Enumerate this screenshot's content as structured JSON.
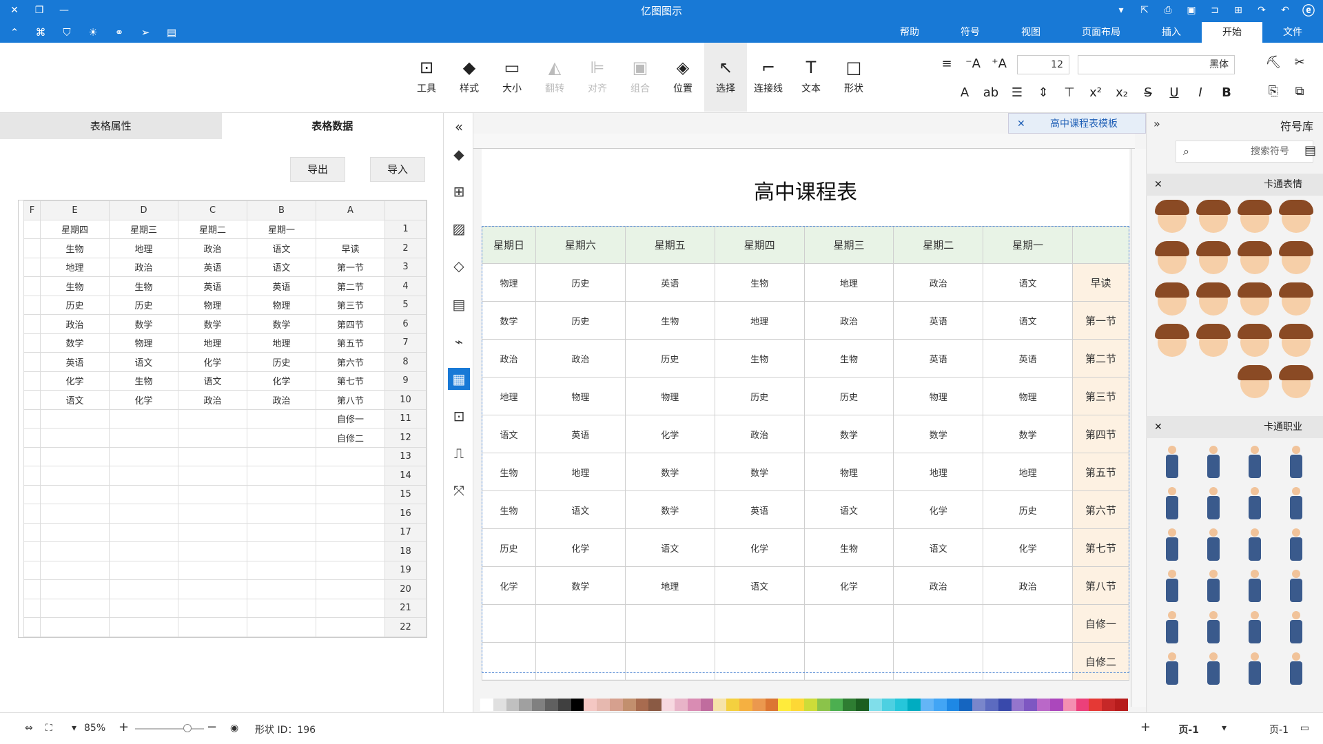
{
  "titlebar": {
    "title": "亿图图示"
  },
  "tabs": [
    "开始",
    "插入",
    "页面布局",
    "视图",
    "符号",
    "帮助"
  ],
  "active_tab": "开始",
  "toolbar": {
    "font_name": "黑体",
    "font_size": "12",
    "tools": [
      {
        "name": "shape",
        "label": "形状",
        "icon": "□"
      },
      {
        "name": "text",
        "label": "文本",
        "icon": "T"
      },
      {
        "name": "connector",
        "label": "连接线",
        "icon": "⌐"
      },
      {
        "name": "select",
        "label": "选择",
        "icon": "↖"
      },
      {
        "name": "position",
        "label": "位置",
        "icon": "◈"
      },
      {
        "name": "group",
        "label": "组合",
        "icon": "▣"
      },
      {
        "name": "align",
        "label": "对齐",
        "icon": "⊫"
      },
      {
        "name": "flip",
        "label": "翻转",
        "icon": "◭"
      },
      {
        "name": "size",
        "label": "大小",
        "icon": "▭"
      },
      {
        "name": "style",
        "label": "样式",
        "icon": "◆"
      },
      {
        "name": "tools",
        "label": "工具",
        "icon": "⊡"
      }
    ]
  },
  "symbols": {
    "title": "符号库",
    "search_placeholder": "搜索符号",
    "lib1": "卡通表情",
    "lib2": "卡通职业"
  },
  "document": {
    "tab_label": "高中课程表模板",
    "title": "高中课程表",
    "days": [
      "星期一",
      "星期二",
      "星期三",
      "星期四",
      "星期五",
      "星期六",
      "星期日"
    ],
    "periods": [
      "早读",
      "第一节",
      "第二节",
      "第三节",
      "第四节",
      "第五节",
      "第六节",
      "第七节",
      "第八节",
      "自修一",
      "自修二"
    ],
    "rows": [
      [
        "语文",
        "政治",
        "地理",
        "生物",
        "英语",
        "历史",
        "物理"
      ],
      [
        "语文",
        "英语",
        "政治",
        "地理",
        "生物",
        "历史",
        "数学"
      ],
      [
        "英语",
        "英语",
        "生物",
        "生物",
        "历史",
        "政治",
        "政治"
      ],
      [
        "物理",
        "物理",
        "历史",
        "历史",
        "物理",
        "物理",
        "地理"
      ],
      [
        "数学",
        "数学",
        "数学",
        "政治",
        "化学",
        "英语",
        "语文"
      ],
      [
        "地理",
        "地理",
        "物理",
        "数学",
        "数学",
        "地理",
        "生物"
      ],
      [
        "历史",
        "化学",
        "语文",
        "英语",
        "数学",
        "语文",
        "生物"
      ],
      [
        "化学",
        "语文",
        "生物",
        "化学",
        "语文",
        "化学",
        "历史"
      ],
      [
        "政治",
        "政治",
        "化学",
        "语文",
        "地理",
        "数学",
        "化学"
      ],
      [
        "",
        "",
        "",
        "",
        "",
        "",
        ""
      ],
      [
        "",
        "",
        "",
        "",
        "",
        "",
        ""
      ]
    ]
  },
  "data_panel": {
    "tab_data": "表格数据",
    "tab_props": "表格属性",
    "import": "导入",
    "export": "导出",
    "columns": [
      "A",
      "B",
      "C",
      "D",
      "E",
      "F"
    ],
    "grid": [
      [
        "",
        "星期一",
        "星期二",
        "星期三",
        "星期四"
      ],
      [
        "早读",
        "语文",
        "政治",
        "地理",
        "生物"
      ],
      [
        "第一节",
        "语文",
        "英语",
        "政治",
        "地理"
      ],
      [
        "第二节",
        "英语",
        "英语",
        "生物",
        "生物"
      ],
      [
        "第三节",
        "物理",
        "物理",
        "历史",
        "历史"
      ],
      [
        "第四节",
        "数学",
        "数学",
        "数学",
        "政治"
      ],
      [
        "第五节",
        "地理",
        "地理",
        "物理",
        "数学"
      ],
      [
        "第六节",
        "历史",
        "化学",
        "语文",
        "英语"
      ],
      [
        "第七节",
        "化学",
        "语文",
        "生物",
        "化学"
      ],
      [
        "第八节",
        "政治",
        "政治",
        "化学",
        "语文"
      ],
      [
        "自修一",
        "",
        "",
        "",
        ""
      ],
      [
        "自修二",
        "",
        "",
        "",
        ""
      ],
      [
        "",
        "",
        "",
        "",
        ""
      ],
      [
        "",
        "",
        "",
        "",
        ""
      ],
      [
        "",
        "",
        "",
        "",
        ""
      ],
      [
        "",
        "",
        "",
        "",
        ""
      ],
      [
        "",
        "",
        "",
        "",
        ""
      ],
      [
        "",
        "",
        "",
        "",
        ""
      ],
      [
        "",
        "",
        "",
        "",
        ""
      ],
      [
        "",
        "",
        "",
        "",
        ""
      ],
      [
        "",
        "",
        "",
        "",
        ""
      ],
      [
        "",
        "",
        "",
        "",
        ""
      ]
    ]
  },
  "status": {
    "page_label": "页-1",
    "page_tab": "页-1",
    "shape_id": "形状 ID：196",
    "zoom": "85%"
  },
  "colors": {
    "accent": "#1879d6",
    "header_green": "#e8f3e6",
    "period_cream": "#fdf1e2"
  }
}
